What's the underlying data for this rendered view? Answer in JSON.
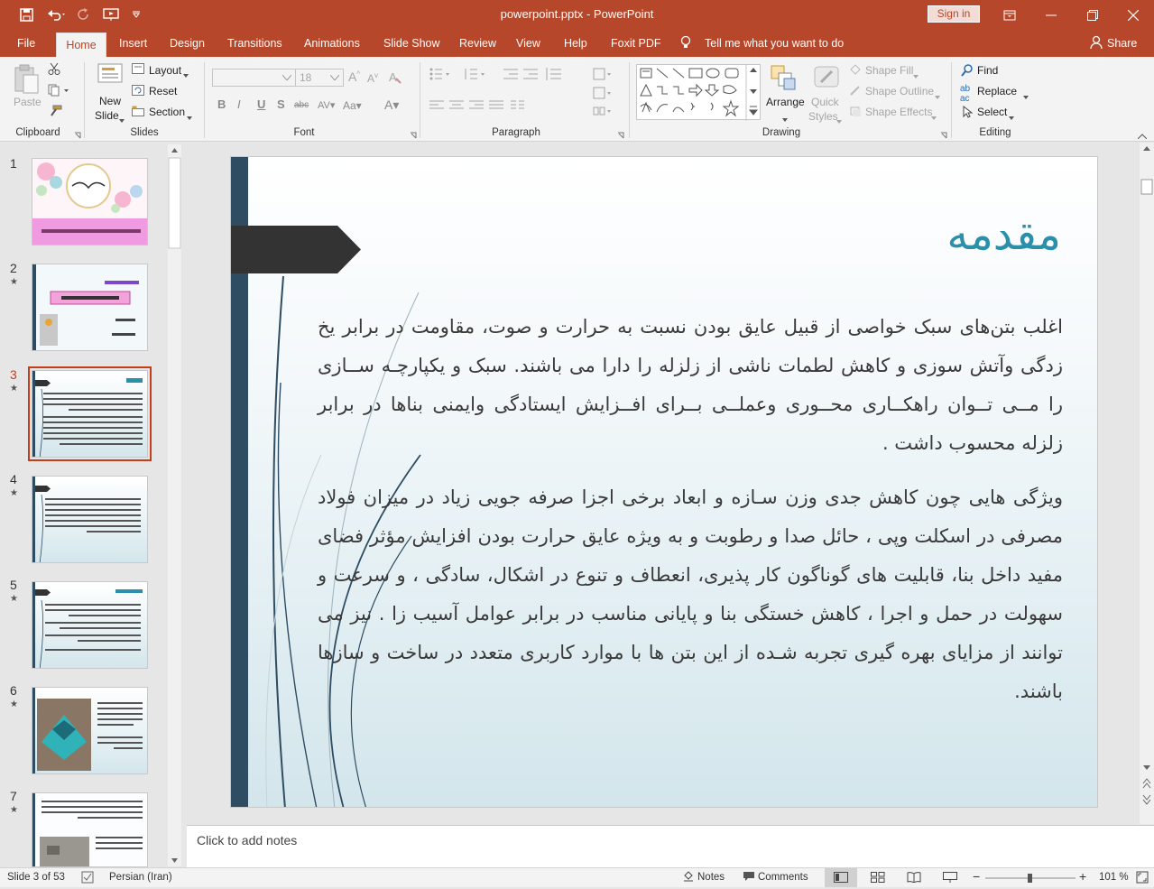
{
  "window": {
    "title": "powerpoint.pptx  -  PowerPoint",
    "sign_in": "Sign in"
  },
  "tabs": [
    "File",
    "Home",
    "Insert",
    "Design",
    "Transitions",
    "Animations",
    "Slide Show",
    "Review",
    "View",
    "Help",
    "Foxit PDF"
  ],
  "tell_me": "Tell me what you want to do",
  "share": "Share",
  "ribbon": {
    "clipboard": {
      "paste": "Paste",
      "label": "Clipboard"
    },
    "slides": {
      "new_slide_line1": "New",
      "new_slide_line2": "Slide",
      "layout": "Layout",
      "reset": "Reset",
      "section": "Section",
      "label": "Slides"
    },
    "font": {
      "font_size": "18",
      "label": "Font"
    },
    "paragraph": {
      "label": "Paragraph"
    },
    "drawing": {
      "arrange": "Arrange",
      "quick_styles_line1": "Quick",
      "quick_styles_line2": "Styles",
      "shape_fill": "Shape Fill",
      "shape_outline": "Shape Outline",
      "shape_effects": "Shape Effects",
      "label": "Drawing"
    },
    "editing": {
      "find": "Find",
      "replace": "Replace",
      "select": "Select",
      "label": "Editing"
    }
  },
  "thumbnails": [
    {
      "num": "1",
      "star": ""
    },
    {
      "num": "2",
      "star": "★"
    },
    {
      "num": "3",
      "star": "★"
    },
    {
      "num": "4",
      "star": "★"
    },
    {
      "num": "5",
      "star": "★"
    },
    {
      "num": "6",
      "star": "★"
    },
    {
      "num": "7",
      "star": "★"
    }
  ],
  "slide": {
    "title": "مقدمه",
    "para1": "اغلب بتن‌های سبک خواصی از قبیل عایق بودن نسبت به حرارت و صوت، مقاومت در برابر یخ زدگی  وآتش سوزی و کاهش لطمات ناشی از زلزله را دارا می باشند. سبک و یکپارچـه ســازی را مــی تــوان راهکــاری محــوری وعملــی بــرای افــزایش ایستادگی وایمنی بناها در برابر زلزله محسوب داشت .",
    "para2": "ویژگی هایی چون کاهش جدی وزن سـازه و ابعاد برخی اجزا صرفه جویی زیاد در میزان فولاد مصرفی در اسکلت وپی ، حائل صدا و رطوبت و به ویژه عایق حرارت بودن افزایش مؤثر فضای مفید داخل بنا، قابلیت های گوناگون کار پذیری، انعطاف و تنوع در اشکال، سادگی ، و سرعت و سهولت در حمل و اجرا ، کاهش خستگی بنا و پایانی مناسب در برابر عوامل آسیب زا . نیز می توانند از مزایای بهره گیری تجربه شـده از این بتن ها با موارد کاربری متعدد در ساخت و سازها باشند."
  },
  "notes_placeholder": "Click to add notes",
  "status": {
    "slide_info": "Slide 3 of 53",
    "language": "Persian (Iran)",
    "notes": "Notes",
    "comments": "Comments",
    "zoom": "101 %"
  },
  "colors": {
    "accent": "#b7472a",
    "slide_title": "#2a8fa9",
    "slide_bar": "#2e4c62"
  }
}
